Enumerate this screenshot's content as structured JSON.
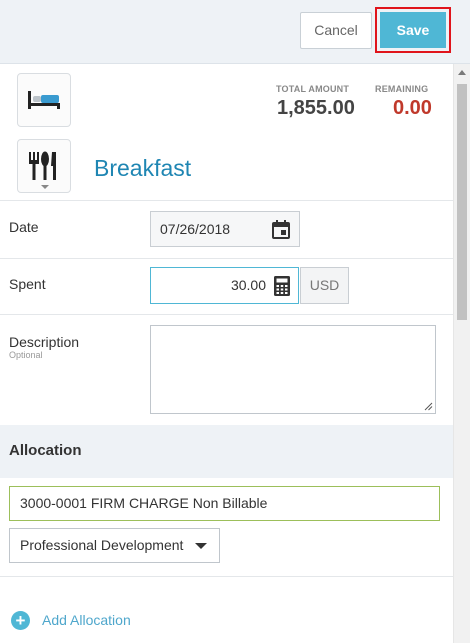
{
  "toolbar": {
    "cancel_label": "Cancel",
    "save_label": "Save"
  },
  "summary": {
    "total_label": "TOTAL AMOUNT",
    "total_value": "1,855.00",
    "remaining_label": "REMAINING",
    "remaining_value": "0.00",
    "remaining_color": "#c0392b"
  },
  "expense": {
    "trip_icon": "hotel-bed-icon",
    "category_icon": "fork-knife-spoon-icon",
    "category": "Breakfast"
  },
  "form": {
    "date_label": "Date",
    "date_value": "07/26/2018",
    "spent_label": "Spent",
    "spent_value": "30.00",
    "currency": "USD",
    "description_label": "Description",
    "description_hint": "Optional",
    "description_value": ""
  },
  "allocation": {
    "title": "Allocation",
    "code": "3000-0001 FIRM CHARGE Non Billable",
    "category": "Professional Development",
    "add_label": "Add Allocation"
  },
  "colors": {
    "accent": "#4fb7d5",
    "title_blue": "#1f86b3",
    "highlight_red": "#e0141b"
  }
}
